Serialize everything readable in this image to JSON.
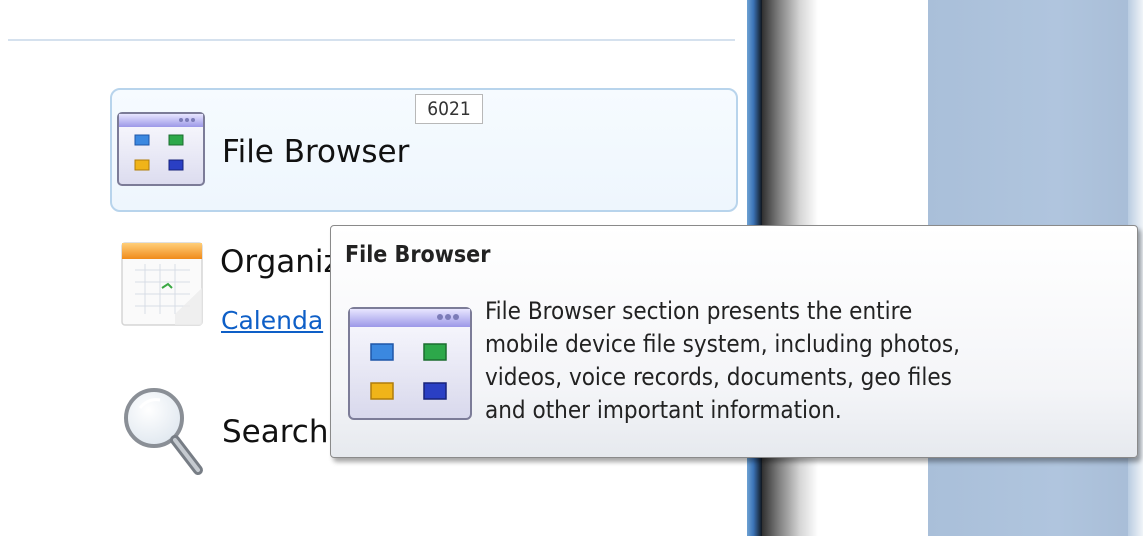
{
  "sections": {
    "file_browser": {
      "label": "File Browser",
      "count": "6021",
      "icon": "file-browser-icon"
    },
    "organizer": {
      "label": "Organiz",
      "link": "Calenda",
      "icon": "calendar-icon"
    },
    "search": {
      "label": "Search",
      "icon": "search-icon"
    }
  },
  "tooltip": {
    "title": "File Browser",
    "lines": [
      "File Browser section presents the entire",
      "mobile device file system, including photos,",
      "videos, voice records, documents, geo files",
      "and other important information."
    ],
    "icon": "file-browser-icon"
  },
  "colors": {
    "link": "#0e5fc7",
    "selection_border": "#b8d4ec",
    "right_panel": "#a9bfd9"
  }
}
